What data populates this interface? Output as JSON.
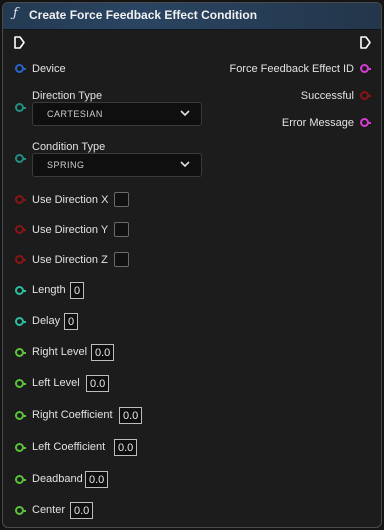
{
  "node": {
    "title": "Create Force Feedback Effect Condition",
    "function_icon": "function-icon"
  },
  "inputs": {
    "device": {
      "label": "Device",
      "pin_color": "#2a63c8"
    },
    "direction_type": {
      "label": "Direction Type",
      "value": "CARTESIAN",
      "pin_color": "#1f8f86"
    },
    "condition_type": {
      "label": "Condition Type",
      "value": "SPRING",
      "pin_color": "#1f8f86"
    },
    "use_direction_x": {
      "label": "Use Direction X",
      "pin_color": "#8b1515"
    },
    "use_direction_y": {
      "label": "Use Direction Y",
      "pin_color": "#8b1515"
    },
    "use_direction_z": {
      "label": "Use Direction Z",
      "pin_color": "#8b1515"
    },
    "length": {
      "label": "Length",
      "value": "0",
      "pin_color": "#2bbfa0"
    },
    "delay": {
      "label": "Delay",
      "value": "0",
      "pin_color": "#2bbfa0"
    },
    "right_level": {
      "label": "Right Level",
      "value": "0.0",
      "pin_color": "#5cc23a"
    },
    "left_level": {
      "label": "Left Level",
      "value": "0.0",
      "pin_color": "#5cc23a"
    },
    "right_coefficient": {
      "label": "Right Coefficient",
      "value": "0.0",
      "pin_color": "#5cc23a"
    },
    "left_coefficient": {
      "label": "Left Coefficient",
      "value": "0.0",
      "pin_color": "#5cc23a"
    },
    "deadband": {
      "label": "Deadband",
      "value": "0.0",
      "pin_color": "#5cc23a"
    },
    "center": {
      "label": "Center",
      "value": "0.0",
      "pin_color": "#5cc23a"
    }
  },
  "outputs": {
    "effect_id": {
      "label": "Force Feedback Effect ID",
      "pin_color": "#d63bd6"
    },
    "successful": {
      "label": "Successful",
      "pin_color": "#8b1515"
    },
    "error_message": {
      "label": "Error Message",
      "pin_color": "#d63bd6"
    }
  }
}
